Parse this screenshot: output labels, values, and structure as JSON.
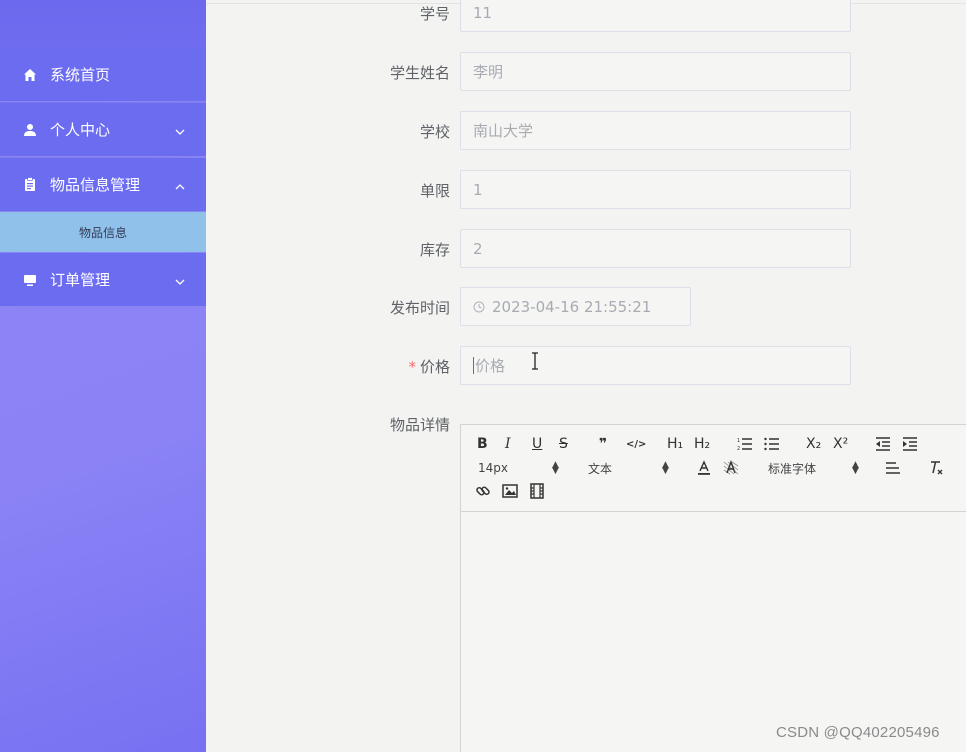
{
  "sidebar": {
    "items": [
      {
        "label": "系统首页",
        "icon": "home-icon"
      },
      {
        "label": "个人中心",
        "icon": "user-icon",
        "arrow": "chevron-down-icon"
      },
      {
        "label": "物品信息管理",
        "icon": "clipboard-icon",
        "arrow": "chevron-up-icon"
      },
      {
        "label": "订单管理",
        "icon": "monitor-icon",
        "arrow": "chevron-down-icon"
      }
    ],
    "subitem": {
      "label": "物品信息"
    }
  },
  "form": {
    "student_no": {
      "label": "学号",
      "value": "11"
    },
    "student_name": {
      "label": "学生姓名",
      "value": "李明"
    },
    "school": {
      "label": "学校",
      "value": "南山大学"
    },
    "single_limit": {
      "label": "单限",
      "value": "1"
    },
    "stock": {
      "label": "库存",
      "value": "2"
    },
    "publish_time": {
      "label": "发布时间",
      "value": "2023-04-16 21:55:21"
    },
    "price": {
      "label": "价格",
      "required_mark": "*",
      "placeholder": "价格"
    },
    "detail": {
      "label": "物品详情"
    }
  },
  "editor": {
    "toolbar": {
      "bold": "B",
      "italic": "I",
      "underline": "U",
      "strike": "S",
      "quote": "❞",
      "code": "</>",
      "h1": "H₁",
      "h2": "H₂",
      "subscript": "X₂",
      "superscript": "X²",
      "font_size": "14px",
      "paragraph": "文本",
      "font_family": "标准字体"
    }
  },
  "colors": {
    "sidebar_bg": "#6c6cf1",
    "submenu_active": "#8fc1ea",
    "required": "#f56c6c"
  },
  "watermark": "CSDN @QQ402205496"
}
